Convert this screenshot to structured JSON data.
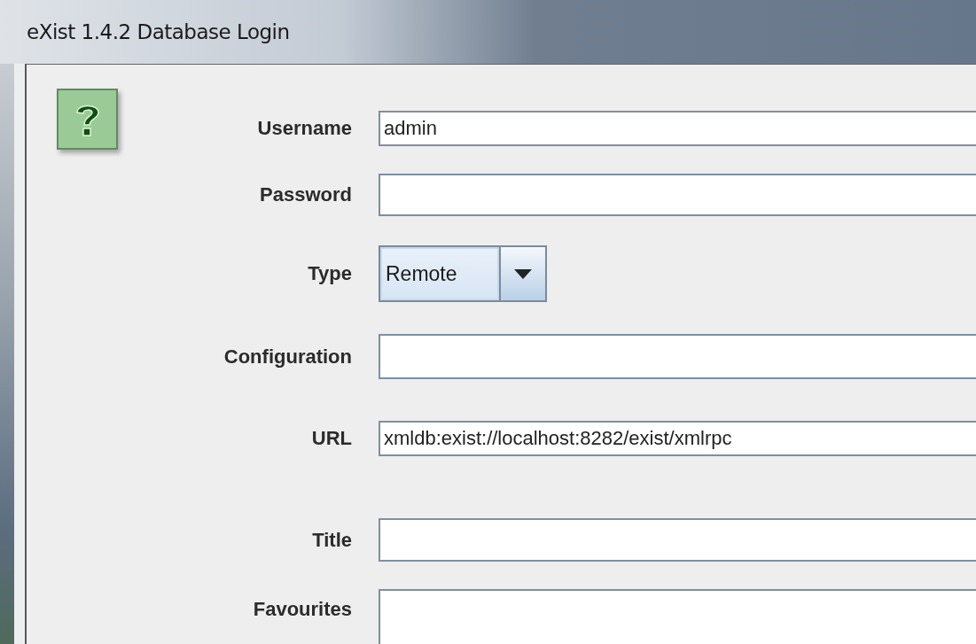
{
  "window": {
    "title": "eXist 1.4.2 Database Login"
  },
  "fields": [
    {
      "label": "Username",
      "kind": "text",
      "value": "admin"
    },
    {
      "label": "Password",
      "kind": "password"
    },
    {
      "label": "Type",
      "kind": "combo",
      "value": "Remote"
    },
    {
      "label": "Configuration",
      "kind": "text"
    },
    {
      "label": "URL",
      "kind": "text",
      "value": "xmldb:exist://localhost:8282/exist/xmlrpc"
    },
    {
      "label": "Title",
      "kind": "text"
    },
    {
      "label": "Favourites",
      "kind": "list"
    }
  ]
}
